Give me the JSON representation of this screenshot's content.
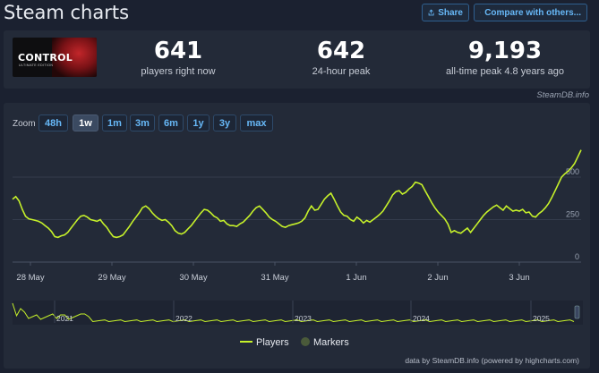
{
  "header": {
    "title": "Steam charts",
    "share_label": "Share",
    "compare_label": "Compare with others..."
  },
  "game": {
    "logo_text": "CONTROL",
    "logo_subtext": "ULTIMATE EDITION"
  },
  "stats": [
    {
      "value": "641",
      "label": "players right now"
    },
    {
      "value": "642",
      "label": "24-hour peak"
    },
    {
      "value": "9,193",
      "label": "all-time peak 4.8 years ago"
    }
  ],
  "credit_top": "SteamDB.info",
  "zoom": {
    "label": "Zoom",
    "options": [
      "48h",
      "1w",
      "1m",
      "3m",
      "6m",
      "1y",
      "3y",
      "max"
    ],
    "active": "1w"
  },
  "chart_data": {
    "type": "line",
    "series": [
      {
        "name": "Players",
        "color": "#c6f12a"
      }
    ],
    "x_ticks": [
      "28 May",
      "29 May",
      "30 May",
      "31 May",
      "1 Jun",
      "2 Jun",
      "3 Jun"
    ],
    "y_ticks": [
      "0",
      "250",
      "500"
    ],
    "ylim": [
      0,
      700
    ],
    "values": [
      370,
      385,
      360,
      310,
      270,
      255,
      250,
      245,
      240,
      230,
      215,
      200,
      180,
      150,
      145,
      155,
      160,
      175,
      200,
      225,
      250,
      270,
      275,
      265,
      250,
      245,
      240,
      250,
      225,
      205,
      175,
      150,
      145,
      150,
      160,
      185,
      210,
      240,
      265,
      290,
      320,
      330,
      315,
      290,
      270,
      255,
      245,
      250,
      235,
      215,
      185,
      170,
      165,
      175,
      195,
      215,
      240,
      265,
      290,
      310,
      305,
      290,
      270,
      260,
      240,
      245,
      225,
      215,
      215,
      210,
      225,
      235,
      255,
      275,
      300,
      320,
      330,
      310,
      290,
      265,
      250,
      240,
      225,
      210,
      205,
      215,
      220,
      225,
      230,
      240,
      260,
      300,
      330,
      305,
      310,
      340,
      370,
      390,
      405,
      370,
      330,
      295,
      275,
      270,
      250,
      240,
      265,
      250,
      230,
      245,
      235,
      250,
      265,
      280,
      300,
      330,
      360,
      395,
      415,
      420,
      400,
      410,
      430,
      445,
      470,
      465,
      455,
      420,
      385,
      350,
      320,
      295,
      275,
      255,
      225,
      175,
      185,
      175,
      170,
      185,
      200,
      175,
      200,
      225,
      250,
      275,
      295,
      310,
      325,
      335,
      320,
      305,
      330,
      315,
      300,
      305,
      300,
      310,
      290,
      295,
      270,
      265,
      285,
      300,
      320,
      345,
      380,
      420,
      460,
      500,
      520,
      535,
      555,
      580,
      620,
      660
    ],
    "navigator_ticks": [
      "2021",
      "2022",
      "2023",
      "2024",
      "2025"
    ],
    "legend": [
      {
        "name": "Players",
        "color": "#c6f12a"
      },
      {
        "name": "Markers",
        "color": "#4a5a3a"
      }
    ]
  },
  "credit_bottom": "data by SteamDB.info (powered by highcharts.com)"
}
